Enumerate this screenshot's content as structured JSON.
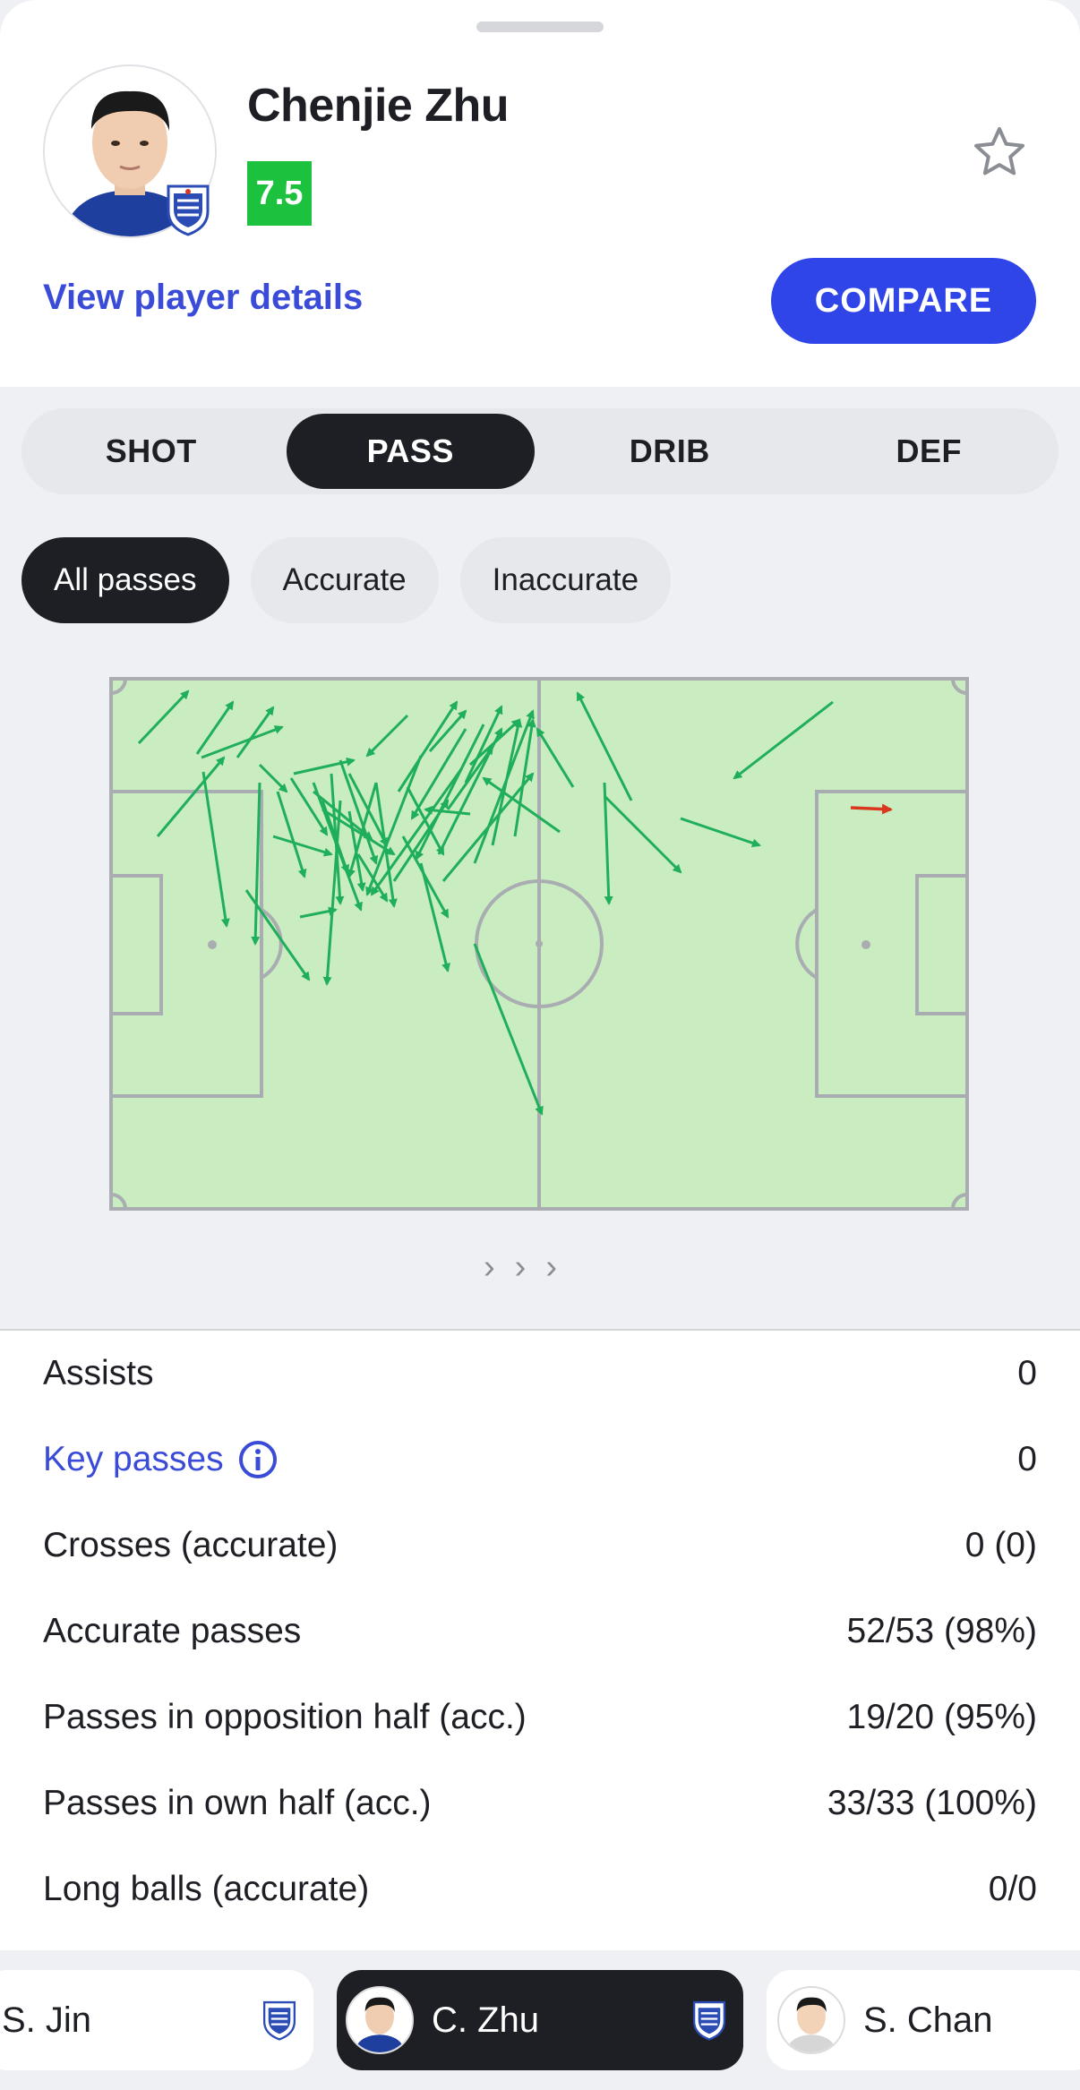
{
  "player": {
    "name": "Chenjie Zhu",
    "rating": "7.5",
    "view_details": "View player details",
    "compare_label": "COMPARE"
  },
  "tabs": [
    "SHOT",
    "PASS",
    "DRIB",
    "DEF"
  ],
  "active_tab": "PASS",
  "filters": [
    "All passes",
    "Accurate",
    "Inaccurate"
  ],
  "active_filter": "All passes",
  "pass_map": {
    "accurate_color": "#1fae5b",
    "inaccurate_color": "#d9381e",
    "pitch_color": "#c9ecc0",
    "line_color": "#a9acb0"
  },
  "stats": [
    {
      "label": "Assists",
      "value": "0"
    },
    {
      "label": "Key passes",
      "value": "0"
    },
    {
      "label": "Crosses (accurate)",
      "value": "0 (0)"
    },
    {
      "label": "Accurate passes",
      "value": "52/53 (98%)"
    },
    {
      "label": "Passes in opposition half (acc.)",
      "value": "19/20 (95%)"
    },
    {
      "label": "Passes in own half (acc.)",
      "value": "33/33 (100%)"
    },
    {
      "label": "Long balls (accurate)",
      "value": "0/0"
    }
  ],
  "bottom_players": [
    {
      "name": "S. Jin"
    },
    {
      "name": "C. Zhu"
    },
    {
      "name": "S. Chan"
    }
  ]
}
